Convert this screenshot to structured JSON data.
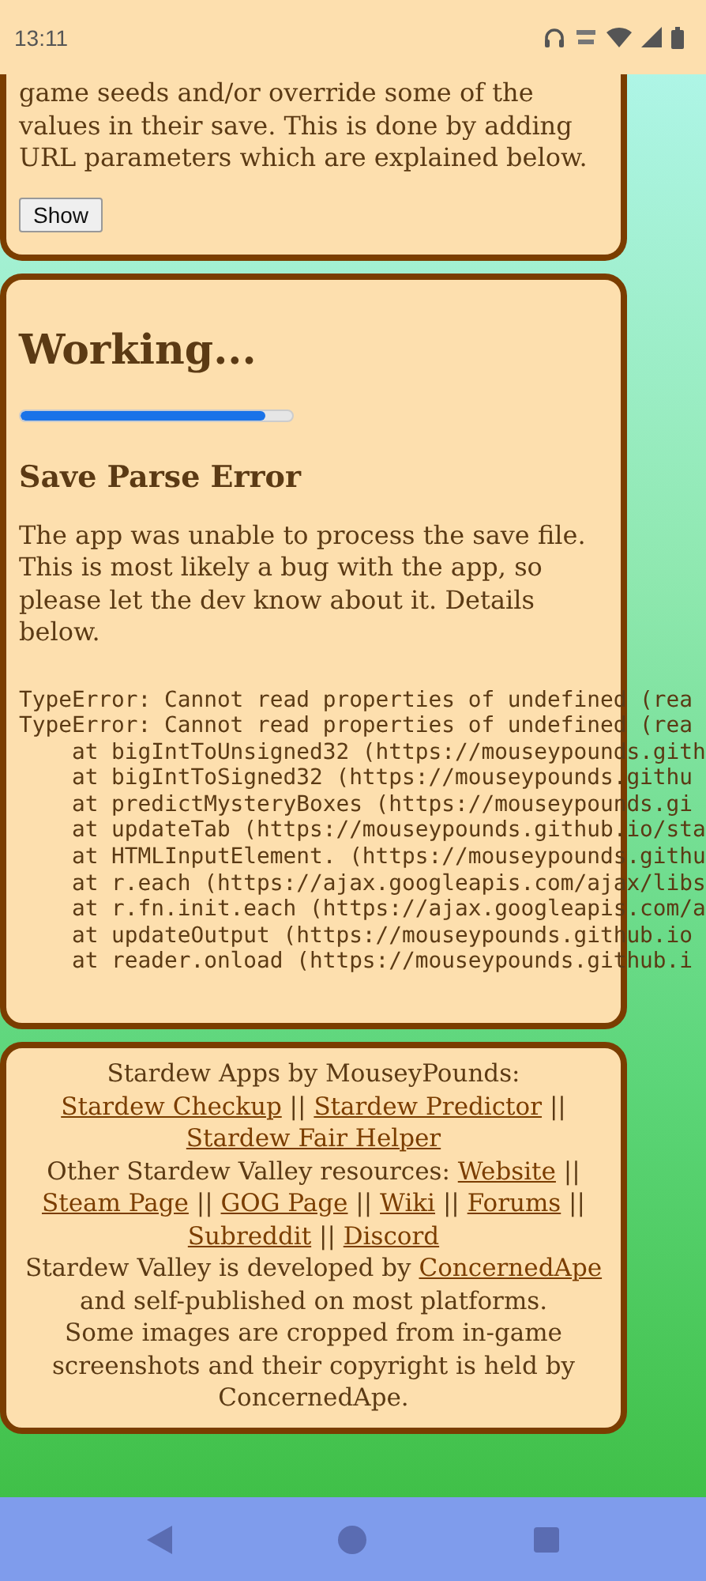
{
  "status_bar": {
    "time": "13:11"
  },
  "intro_card": {
    "text": "game seeds and/or override some of the values in their save. This is done by adding URL parameters which are explained below.",
    "button": "Show"
  },
  "working_card": {
    "title": "Working...",
    "progress": {
      "level": 0.9
    },
    "error_title": "Save Parse Error",
    "message": "The app was unable to process the save file. This is most likely a bug with the app, so please let the dev know about it. Details below.",
    "trace": [
      "TypeError: Cannot read properties of undefined (rea",
      "TypeError: Cannot read properties of undefined (rea",
      "    at bigIntToUnsigned32 (https://mouseypounds.gith",
      "    at bigIntToSigned32 (https://mouseypounds.githu",
      "    at predictMysteryBoxes (https://mouseypounds.gi",
      "    at updateTab (https://mouseypounds.github.io/sta",
      "    at HTMLInputElement. (https://mouseypounds.githu",
      "    at r.each (https://ajax.googleapis.com/ajax/libs",
      "    at r.fn.init.each (https://ajax.googleapis.com/a",
      "    at updateOutput (https://mouseypounds.github.io",
      "    at reader.onload (https://mouseypounds.github.i"
    ]
  },
  "footer": {
    "paragraphs": [
      [
        {
          "kind": "text",
          "text": "Stardew Apps by MouseyPounds: "
        },
        {
          "kind": "link",
          "text": "Stardew Checkup"
        },
        {
          "kind": "text",
          "text": " || "
        },
        {
          "kind": "link",
          "text": "Stardew Predictor"
        },
        {
          "kind": "text",
          "text": " || "
        },
        {
          "kind": "link",
          "text": "Stardew Fair Helper"
        }
      ],
      [
        {
          "kind": "text",
          "text": "Other Stardew Valley resources: "
        },
        {
          "kind": "link",
          "text": "Website"
        },
        {
          "kind": "text",
          "text": " || "
        },
        {
          "kind": "link",
          "text": "Steam Page"
        },
        {
          "kind": "text",
          "text": " || "
        },
        {
          "kind": "link",
          "text": "GOG Page"
        },
        {
          "kind": "text",
          "text": " || "
        },
        {
          "kind": "link",
          "text": "Wiki"
        },
        {
          "kind": "text",
          "text": " || "
        },
        {
          "kind": "link",
          "text": "Forums"
        },
        {
          "kind": "text",
          "text": " || "
        },
        {
          "kind": "link",
          "text": "Subreddit"
        },
        {
          "kind": "text",
          "text": " || "
        },
        {
          "kind": "link",
          "text": "Discord"
        }
      ],
      [
        {
          "kind": "text",
          "text": "Stardew Valley is developed by "
        },
        {
          "kind": "link",
          "text": "ConcernedApe"
        },
        {
          "kind": "text",
          "text": " and self-published on most platforms."
        }
      ],
      [
        {
          "kind": "text",
          "text": "Some images are cropped from in-game screenshots and their copyright is held by ConcernedApe."
        }
      ]
    ]
  }
}
